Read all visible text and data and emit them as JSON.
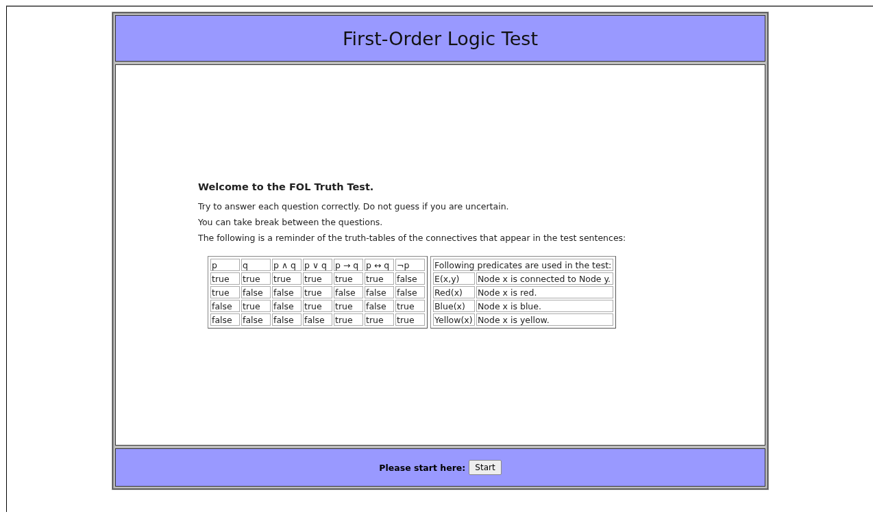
{
  "header": {
    "title": "First-Order Logic Test"
  },
  "intro": {
    "heading": "Welcome to the FOL Truth Test.",
    "paragraphs": [
      "Try to answer each question correctly. Do not guess if you are uncertain.",
      "You can take break between the questions.",
      "The following is a reminder of the truth-tables of the connectives that appear in the test sentences:"
    ]
  },
  "truth_table": {
    "columns": [
      "p",
      "q",
      "p ∧ q",
      "p ∨ q",
      "p → q",
      "p ↔ q",
      "¬p"
    ],
    "rows": [
      [
        "true",
        "true",
        "true",
        "true",
        "true",
        "true",
        "false"
      ],
      [
        "true",
        "false",
        "false",
        "true",
        "false",
        "false",
        "false"
      ],
      [
        "false",
        "true",
        "false",
        "true",
        "true",
        "false",
        "true"
      ],
      [
        "false",
        "false",
        "false",
        "false",
        "true",
        "true",
        "true"
      ]
    ]
  },
  "predicates_table": {
    "heading": "Following predicates are used in the test:",
    "rows": [
      [
        "E(x,y)",
        "Node x is connected to Node y."
      ],
      [
        "Red(x)",
        "Node x is red."
      ],
      [
        "Blue(x)",
        "Node x is blue."
      ],
      [
        "Yellow(x)",
        "Node x is yellow."
      ]
    ]
  },
  "footer": {
    "prompt": "Please start here:",
    "button": "Start"
  }
}
